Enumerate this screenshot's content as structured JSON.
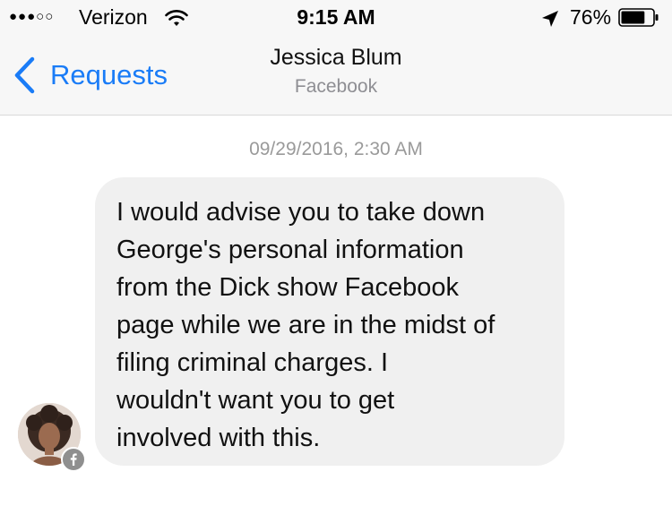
{
  "status_bar": {
    "signal": "●●●○○",
    "carrier": "Verizon",
    "time": "9:15 AM",
    "battery_percent": "76%",
    "battery_level": 0.76
  },
  "nav": {
    "back_label": "Requests",
    "title": "Jessica Blum",
    "subtitle": "Facebook"
  },
  "conversation": {
    "timestamp": "09/29/2016, 2:30 AM",
    "messages": [
      {
        "text": "I would advise you to take down\nGeorge's personal information\nfrom the Dick show Facebook\npage while we are in the midst of\nfiling criminal charges.  I\nwouldn't want you to get\ninvolved with this."
      }
    ]
  },
  "colors": {
    "accent": "#1a7cf7",
    "header_bg": "#f7f7f7",
    "bubble_bg": "#f0f0f0",
    "muted_text": "#8e8e93"
  },
  "icons": {
    "wifi": "wifi-icon",
    "location": "location-arrow-icon",
    "battery": "battery-icon",
    "back": "chevron-left-icon",
    "badge": "facebook-icon"
  }
}
